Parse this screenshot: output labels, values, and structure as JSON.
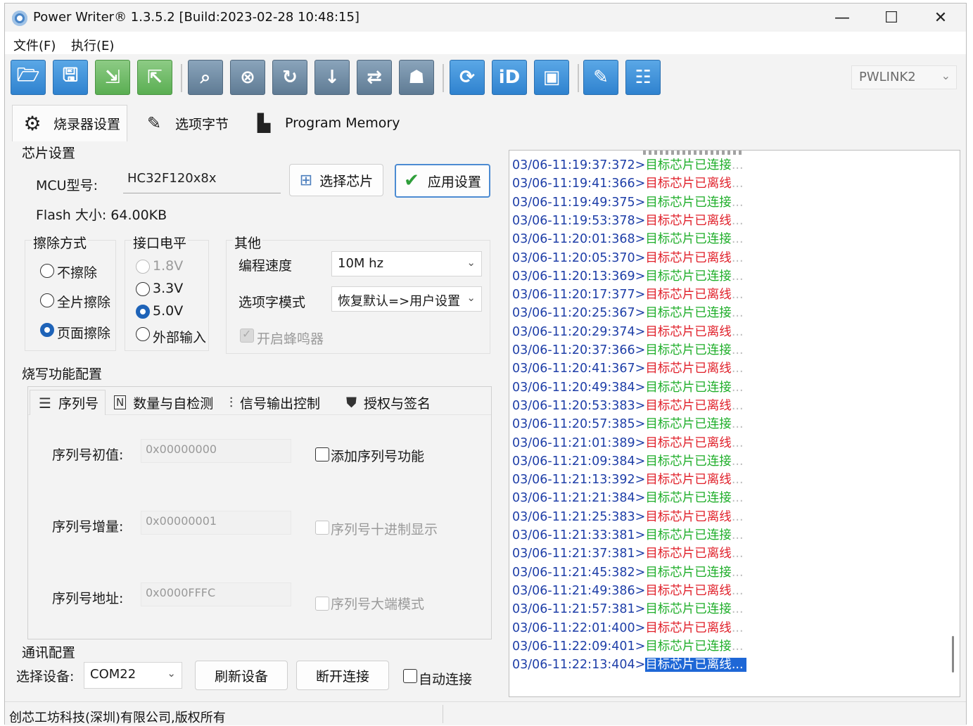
{
  "window": {
    "title": "Power Writer® 1.3.5.2 [Build:2023-02-28 10:48:15]",
    "controls": {
      "minimize": "—",
      "maximize": "☐",
      "close": "✕"
    }
  },
  "menu": {
    "file": "文件(F)",
    "execute": "执行(E)"
  },
  "toolbar": {
    "icons": [
      "open-folder-icon",
      "save-icon",
      "import-icon",
      "export-icon",
      "search-icon",
      "erase-chip-icon",
      "read-chip-icon",
      "write-chip-icon",
      "verify-chip-icon",
      "robot-icon",
      "refresh-icon",
      "chip-id-icon",
      "chip-icon",
      "auto-burn-icon",
      "settings-list-icon"
    ],
    "device": "PWLINK2"
  },
  "tabs": [
    {
      "label": "烧录器设置",
      "icon": "gear-icon"
    },
    {
      "label": "选项字节",
      "icon": "edit-icon"
    },
    {
      "label": "Program Memory",
      "icon": "memory-icon"
    }
  ],
  "chip": {
    "group_title": "芯片设置",
    "mcu_label": "MCU型号:",
    "mcu_value": "HC32F120x8x",
    "select_chip": "选择芯片",
    "apply": "应用设置",
    "flash_label": "Flash 大小: 64.00KB"
  },
  "erase": {
    "title": "擦除方式",
    "options": [
      "不擦除",
      "全片擦除",
      "页面擦除"
    ],
    "selected": "页面擦除"
  },
  "voltage": {
    "title": "接口电平",
    "options": [
      "1.8V",
      "3.3V",
      "5.0V",
      "外部输入"
    ],
    "selected": "5.0V"
  },
  "other": {
    "title": "其他",
    "speed_label": "编程速度",
    "speed_value": "10M hz",
    "option_mode_label": "选项字模式",
    "option_mode_value": "恢复默认=>用户设置",
    "buzzer": "开启蜂鸣器"
  },
  "burn": {
    "group_title": "烧写功能配置",
    "subtabs": [
      "序列号",
      "数量与自检测",
      "信号输出控制",
      "授权与签名"
    ],
    "serial_init_label": "序列号初值:",
    "serial_init_value": "0x00000000",
    "serial_inc_label": "序列号增量:",
    "serial_inc_value": "0x00000001",
    "serial_addr_label": "序列号地址:",
    "serial_addr_value": "0x0000FFFC",
    "add_serial": "添加序列号功能",
    "decimal_display": "序列号十进制显示",
    "big_endian": "序列号大端模式"
  },
  "comm": {
    "group_title": "通讯配置",
    "device_label": "选择设备:",
    "device_value": "COM22",
    "refresh": "刷新设备",
    "disconnect": "断开连接",
    "auto_connect": "自动连接"
  },
  "log": {
    "connected": "目标芯片已连接",
    "disconnected": "目标芯片已离线",
    "dots": "...",
    "entries": [
      {
        "t": "03/06-11:19:37:372>",
        "s": "connected"
      },
      {
        "t": "03/06-11:19:41:366>",
        "s": "disconnected"
      },
      {
        "t": "03/06-11:19:49:375>",
        "s": "connected"
      },
      {
        "t": "03/06-11:19:53:378>",
        "s": "disconnected"
      },
      {
        "t": "03/06-11:20:01:368>",
        "s": "connected"
      },
      {
        "t": "03/06-11:20:05:370>",
        "s": "disconnected"
      },
      {
        "t": "03/06-11:20:13:369>",
        "s": "connected"
      },
      {
        "t": "03/06-11:20:17:377>",
        "s": "disconnected"
      },
      {
        "t": "03/06-11:20:25:367>",
        "s": "connected"
      },
      {
        "t": "03/06-11:20:29:374>",
        "s": "disconnected"
      },
      {
        "t": "03/06-11:20:37:366>",
        "s": "connected"
      },
      {
        "t": "03/06-11:20:41:367>",
        "s": "disconnected"
      },
      {
        "t": "03/06-11:20:49:384>",
        "s": "connected"
      },
      {
        "t": "03/06-11:20:53:383>",
        "s": "disconnected"
      },
      {
        "t": "03/06-11:20:57:385>",
        "s": "connected"
      },
      {
        "t": "03/06-11:21:01:389>",
        "s": "disconnected"
      },
      {
        "t": "03/06-11:21:09:384>",
        "s": "connected"
      },
      {
        "t": "03/06-11:21:13:392>",
        "s": "disconnected"
      },
      {
        "t": "03/06-11:21:21:384>",
        "s": "connected"
      },
      {
        "t": "03/06-11:21:25:383>",
        "s": "disconnected"
      },
      {
        "t": "03/06-11:21:33:381>",
        "s": "connected"
      },
      {
        "t": "03/06-11:21:37:381>",
        "s": "disconnected"
      },
      {
        "t": "03/06-11:21:45:382>",
        "s": "connected"
      },
      {
        "t": "03/06-11:21:49:386>",
        "s": "disconnected"
      },
      {
        "t": "03/06-11:21:57:381>",
        "s": "connected"
      },
      {
        "t": "03/06-11:22:01:400>",
        "s": "disconnected"
      },
      {
        "t": "03/06-11:22:09:401>",
        "s": "connected"
      },
      {
        "t": "03/06-11:22:13:404>",
        "s": "disconnected",
        "selected": true
      }
    ]
  },
  "status": {
    "copyright": "创芯工坊科技(深圳)有限公司,版权所有"
  },
  "colors": {
    "accent": "#1e63b8",
    "log_timestamp": "#1f3fa8",
    "log_connected": "#1fae2a",
    "log_disconnected": "#e0202a",
    "toolbar_blue": "#2f82cf",
    "toolbar_green": "#5aae52"
  }
}
